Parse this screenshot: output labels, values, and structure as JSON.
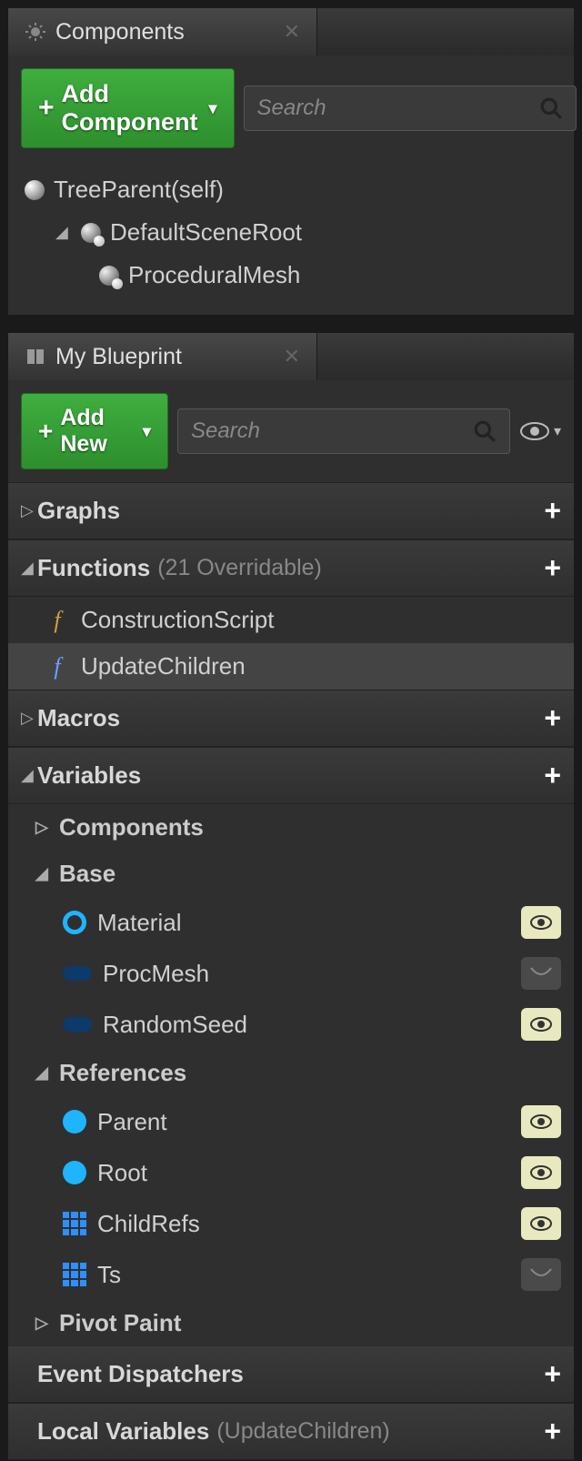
{
  "components": {
    "tab_title": "Components",
    "add_button": "Add Component",
    "search_placeholder": "Search",
    "tree": {
      "root": "TreeParent(self)",
      "scene_root": "DefaultSceneRoot",
      "proc_mesh": "ProceduralMesh"
    }
  },
  "blueprint": {
    "tab_title": "My Blueprint",
    "add_button": "Add New",
    "search_placeholder": "Search",
    "sections": {
      "graphs": {
        "label": "Graphs"
      },
      "functions": {
        "label": "Functions",
        "sub": "(21 Overridable)",
        "items": {
          "construction": "ConstructionScript",
          "update_children": "UpdateChildren"
        }
      },
      "macros": {
        "label": "Macros"
      },
      "variables": {
        "label": "Variables",
        "categories": {
          "components": "Components",
          "base": {
            "label": "Base",
            "items": {
              "material": "Material",
              "procmesh": "ProcMesh",
              "randomseed": "RandomSeed"
            }
          },
          "references": {
            "label": "References",
            "items": {
              "parent": "Parent",
              "root": "Root",
              "childrefs": "ChildRefs",
              "ts": "Ts"
            }
          },
          "pivot": "Pivot Paint"
        }
      },
      "dispatchers": {
        "label": "Event Dispatchers"
      },
      "locals": {
        "label": "Local Variables",
        "sub": "(UpdateChildren)"
      }
    }
  }
}
